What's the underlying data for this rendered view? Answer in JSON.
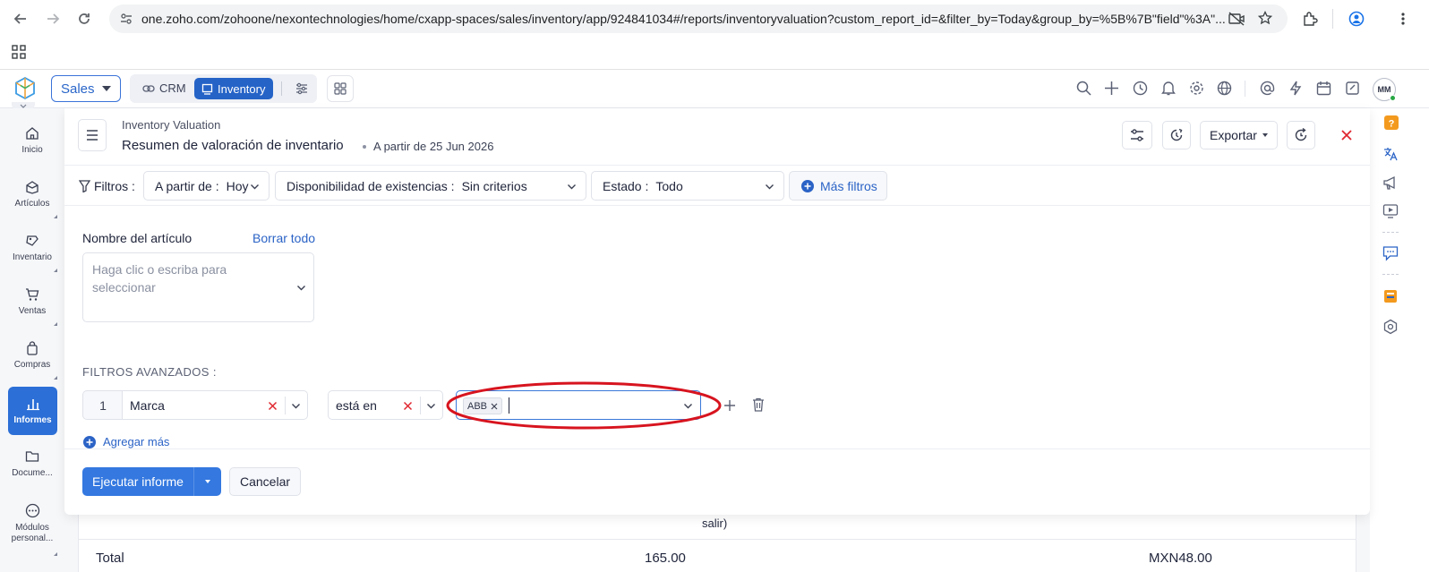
{
  "browser": {
    "url": "one.zoho.com/zohoone/nexontechnologies/home/cxapp-spaces/sales/inventory/app/924841034#/reports/inventoryvaluation?custom_report_id=&filter_by=Today&group_by=%5B%7B\"field\"%3A\"..."
  },
  "topbar": {
    "space_label": "Sales",
    "crm_label": "CRM",
    "inventory_label": "Inventory",
    "avatar_initials": "MM"
  },
  "sidebar": {
    "items": [
      {
        "label": "Inicio",
        "icon": "home-icon"
      },
      {
        "label": "Artículos",
        "icon": "items-icon"
      },
      {
        "label": "Inventario",
        "icon": "inventory-icon"
      },
      {
        "label": "Ventas",
        "icon": "cart-icon"
      },
      {
        "label": "Compras",
        "icon": "bag-icon"
      },
      {
        "label": "Informes",
        "icon": "chart-icon",
        "active": true
      },
      {
        "label": "Docume...",
        "icon": "folder-icon"
      },
      {
        "label": "Módulos personal...",
        "icon": "more-icon"
      }
    ]
  },
  "header": {
    "breadcrumb": "Inventory Valuation",
    "title": "Resumen de valoración de inventario",
    "as_of": "A partir de 25 Jun 2026",
    "export_label": "Exportar"
  },
  "filters": {
    "label": "Filtros :",
    "as_of_label": "A partir de :",
    "as_of_value": "Hoy",
    "stock_label": "Disponibilidad de existencias :",
    "stock_value": "Sin criterios",
    "status_label": "Estado :",
    "status_value": "Todo",
    "more_filters": "Más filtros"
  },
  "item_filter": {
    "label": "Nombre del artículo",
    "clear_all": "Borrar todo",
    "placeholder": "Haga clic o escriba para seleccionar"
  },
  "advanced": {
    "title": "FILTROS AVANZADOS :",
    "row_number": "1",
    "field": "Marca",
    "operator": "está en",
    "tag_value": "ABB",
    "add_more": "Agregar más"
  },
  "actions": {
    "run": "Ejecutar informe",
    "cancel": "Cancelar"
  },
  "table": {
    "partial_header": "salir)",
    "total_label": "Total",
    "total_qty": "165.00",
    "total_value": "MXN48.00"
  },
  "colors": {
    "accent": "#2c6fd6",
    "annotation": "#d7141f"
  }
}
